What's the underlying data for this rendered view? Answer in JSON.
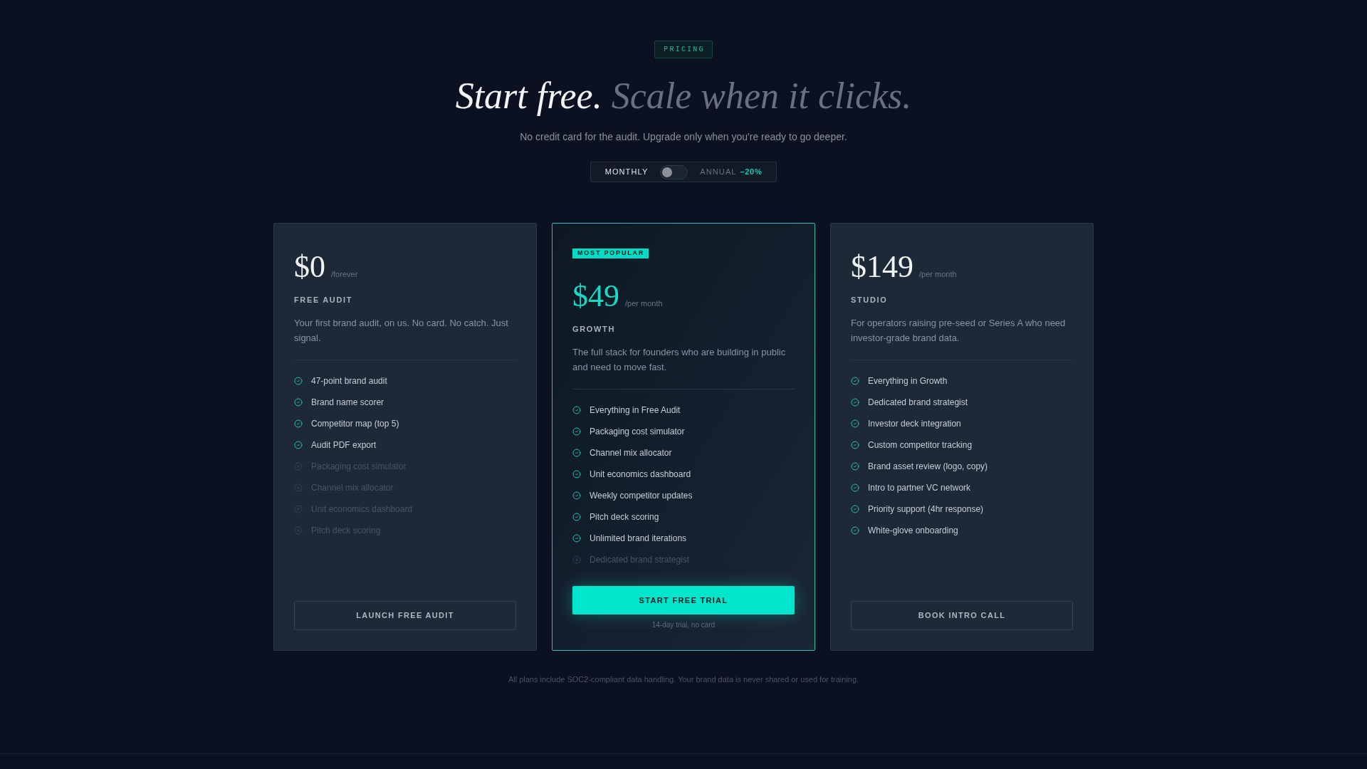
{
  "section_tag": "PRICING",
  "heading": {
    "lead": "Start free.",
    "muted": "Scale when it clicks."
  },
  "subtitle": "No credit card for the audit. Upgrade only when you're ready to go deeper.",
  "billing_toggle": {
    "monthly_label": "MONTHLY",
    "annual_label": "ANNUAL",
    "discount": "–20%",
    "on": false
  },
  "plans": [
    {
      "featured": false,
      "price": "$0",
      "period": "/forever",
      "name": "FREE AUDIT",
      "description": "Your first brand audit, on us. No card. No catch. Just signal.",
      "features": [
        {
          "label": "47-point brand audit",
          "included": true
        },
        {
          "label": "Brand name scorer",
          "included": true
        },
        {
          "label": "Competitor map (top 5)",
          "included": true
        },
        {
          "label": "Audit PDF export",
          "included": true
        },
        {
          "label": "Packaging cost simulator",
          "included": false
        },
        {
          "label": "Channel mix allocator",
          "included": false
        },
        {
          "label": "Unit economics dashboard",
          "included": false
        },
        {
          "label": "Pitch deck scoring",
          "included": false
        }
      ],
      "cta": "LAUNCH FREE AUDIT"
    },
    {
      "featured": true,
      "badge": "MOST POPULAR",
      "price": "$49",
      "period": "/per month",
      "name": "GROWTH",
      "description": "The full stack for founders who are building in public and need to move fast.",
      "features": [
        {
          "label": "Everything in Free Audit",
          "included": true
        },
        {
          "label": "Packaging cost simulator",
          "included": true
        },
        {
          "label": "Channel mix allocator",
          "included": true
        },
        {
          "label": "Unit economics dashboard",
          "included": true
        },
        {
          "label": "Weekly competitor updates",
          "included": true
        },
        {
          "label": "Pitch deck scoring",
          "included": true
        },
        {
          "label": "Unlimited brand iterations",
          "included": true
        },
        {
          "label": "Dedicated brand strategist",
          "included": false
        }
      ],
      "cta": "START FREE TRIAL",
      "cta_note": "14-day trial, no card"
    },
    {
      "featured": false,
      "price": "$149",
      "period": "/per month",
      "name": "STUDIO",
      "description": "For operators raising pre-seed or Series A who need investor-grade brand data.",
      "features": [
        {
          "label": "Everything in Growth",
          "included": true
        },
        {
          "label": "Dedicated brand strategist",
          "included": true
        },
        {
          "label": "Investor deck integration",
          "included": true
        },
        {
          "label": "Custom competitor tracking",
          "included": true
        },
        {
          "label": "Brand asset review (logo, copy)",
          "included": true
        },
        {
          "label": "Intro to partner VC network",
          "included": true
        },
        {
          "label": "Priority support (4hr response)",
          "included": true
        },
        {
          "label": "White-glove onboarding",
          "included": true
        }
      ],
      "cta": "BOOK INTRO CALL"
    }
  ],
  "footer_note": "All plans include SOC2-compliant data handling. Your brand data is never shared or used for training."
}
